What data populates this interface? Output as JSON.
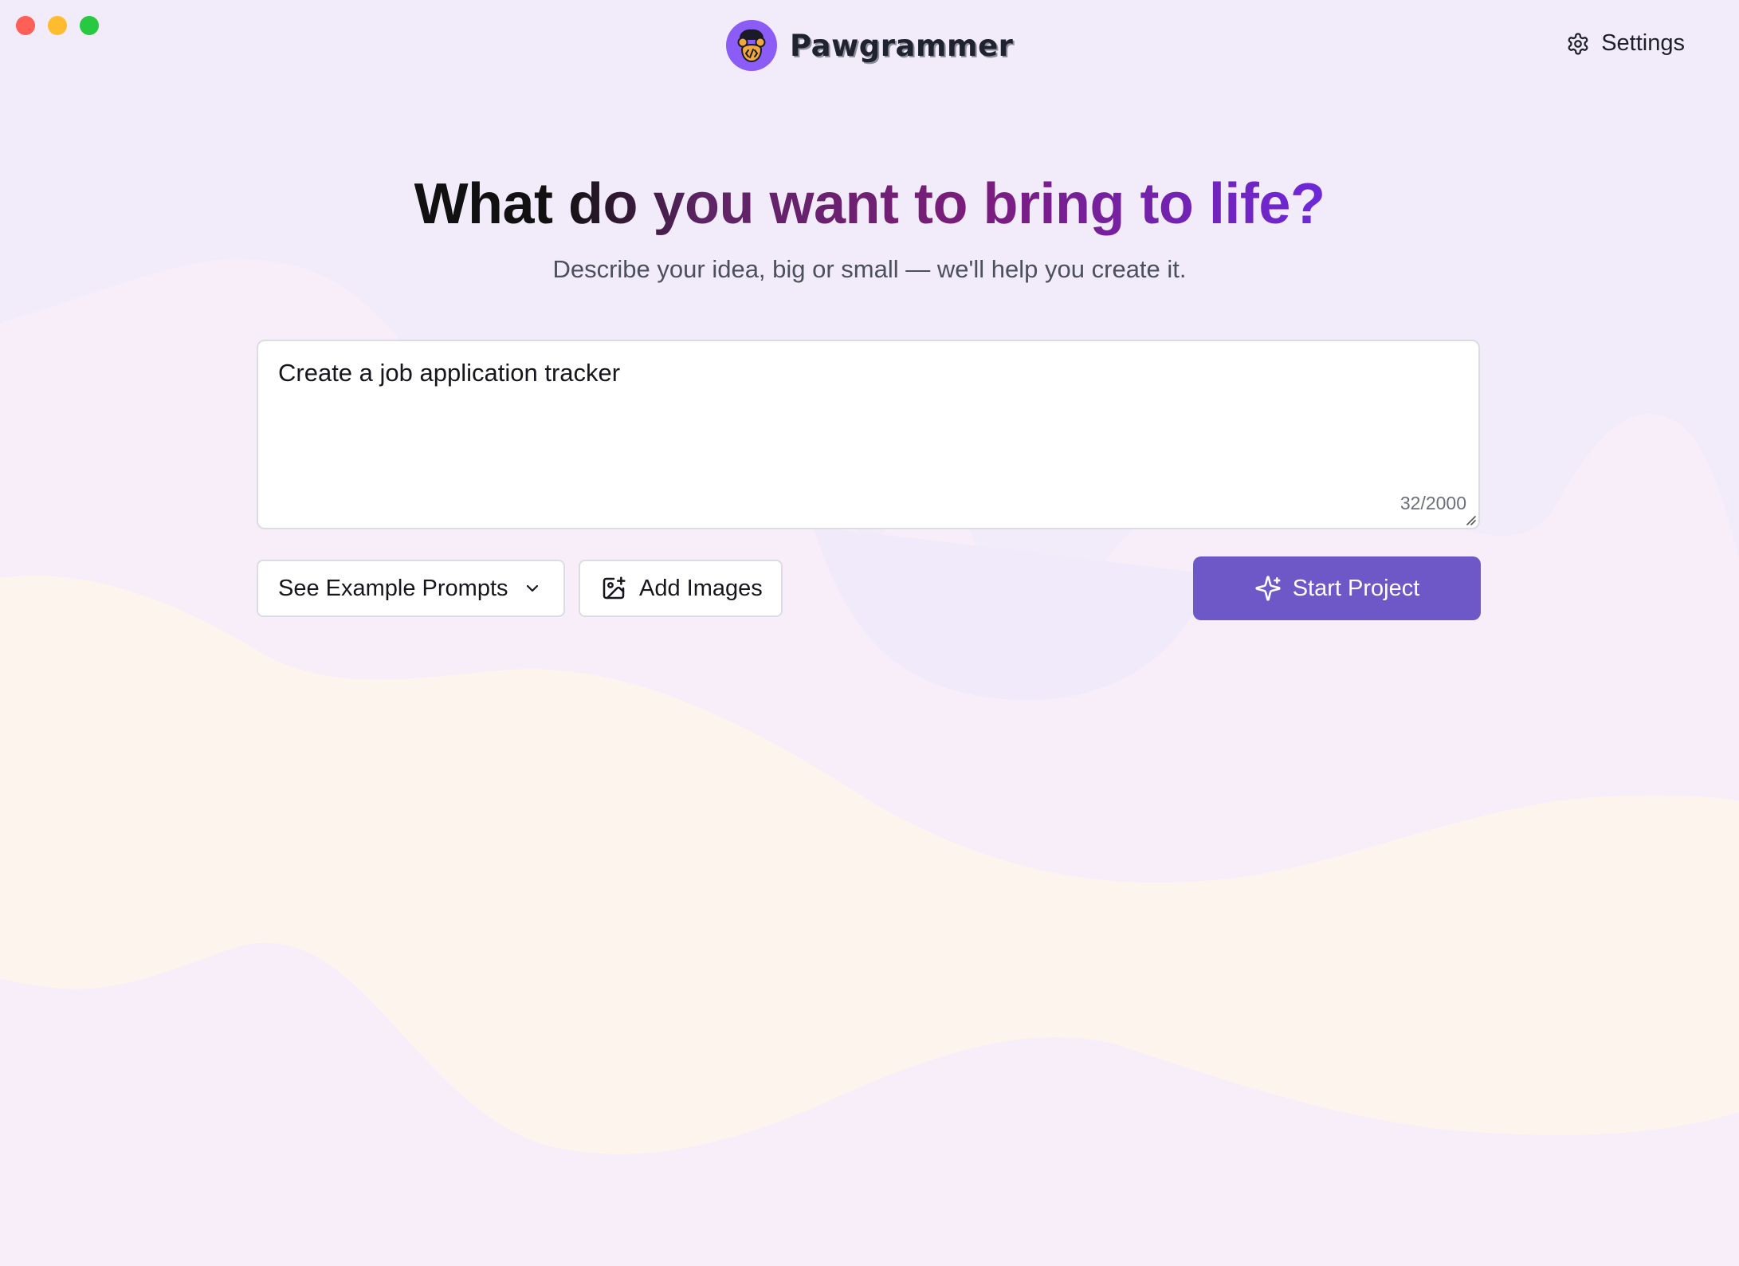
{
  "window": {
    "controls": [
      "close",
      "minimize",
      "maximize"
    ]
  },
  "header": {
    "brand_name": "Pawgrammer",
    "logo_icon": "paw-code-logo-icon",
    "settings_label": "Settings",
    "settings_icon": "gear-icon"
  },
  "hero": {
    "title": "What do you want to bring to life?",
    "subtitle": "Describe your idea, big or small — we'll help you create it."
  },
  "prompt": {
    "value": "Create a job application tracker",
    "char_count": "32/2000"
  },
  "actions": {
    "examples_label": "See Example Prompts",
    "examples_icon": "chevron-down-icon",
    "add_images_label": "Add Images",
    "add_images_icon": "image-add-icon",
    "start_label": "Start Project",
    "start_icon": "sparkles-icon"
  },
  "colors": {
    "background": "#f2ebfa",
    "accent": "#6e58c7",
    "title_gradient_end": "#6d28d9"
  }
}
